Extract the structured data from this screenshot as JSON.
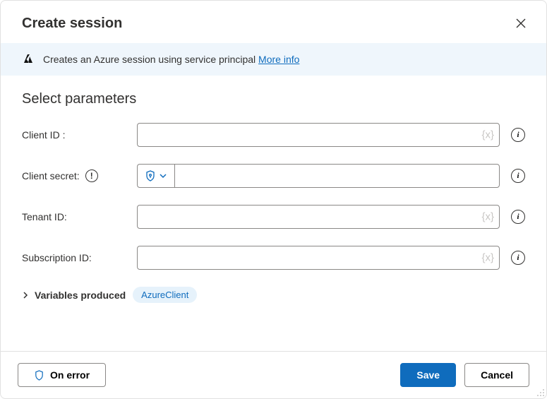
{
  "dialog": {
    "title": "Create session"
  },
  "banner": {
    "text": "Creates an Azure session using service principal ",
    "link": "More info"
  },
  "section": {
    "title": "Select parameters"
  },
  "fields": {
    "clientId": {
      "label": "Client ID :",
      "value": "",
      "placeholder": ""
    },
    "clientSecret": {
      "label": "Client secret:",
      "value": "",
      "placeholder": ""
    },
    "tenantId": {
      "label": "Tenant ID:",
      "value": "",
      "placeholder": ""
    },
    "subscriptionId": {
      "label": "Subscription ID:",
      "value": "",
      "placeholder": ""
    }
  },
  "variables": {
    "label": "Variables produced",
    "chip": "AzureClient"
  },
  "footer": {
    "onError": "On error",
    "save": "Save",
    "cancel": "Cancel"
  },
  "glyphs": {
    "varHint": "{x}"
  }
}
